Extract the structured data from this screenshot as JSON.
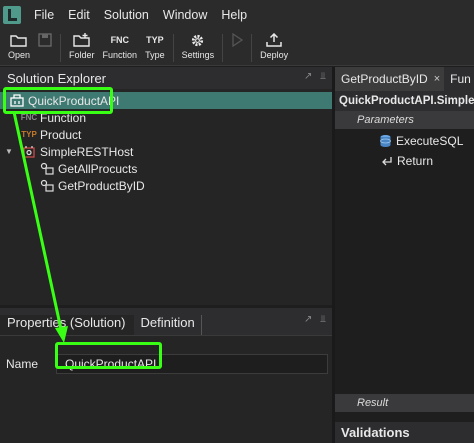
{
  "menu": [
    "File",
    "Edit",
    "Solution",
    "Window",
    "Help"
  ],
  "toolbar": {
    "open": "Open",
    "folder": "Folder",
    "function": "Function",
    "type": "Type",
    "settings": "Settings",
    "deploy": "Deploy",
    "fnc_glyph": "FNC",
    "typ_glyph": "TYP"
  },
  "explorer": {
    "title": "Solution Explorer",
    "root": "QuickProductAPI",
    "items": [
      {
        "badge": "FNC",
        "label": "Function"
      },
      {
        "badge": "TYP",
        "label": "Product"
      },
      {
        "label": "SimpleRESTHost"
      },
      {
        "label": "GetAllProcucts"
      },
      {
        "label": "GetProductByID"
      }
    ]
  },
  "properties": {
    "tab_active": "Properties (Solution)",
    "tab_other": "Definition",
    "name_label": "Name",
    "name_value": "QuickProductAPI"
  },
  "editor": {
    "tab_active": "GetProductByID",
    "tab_close": "×",
    "tab_other": "Fun",
    "path": "QuickProductAPI.SimpleRES",
    "parameters": "Parameters",
    "execute": "ExecuteSQL",
    "return": "Return",
    "result": "Result",
    "validations": "Validations"
  },
  "colors": {
    "highlight": "#39ff14",
    "selected_row": "#3e7a72",
    "type_badge": "#c57a2a"
  }
}
